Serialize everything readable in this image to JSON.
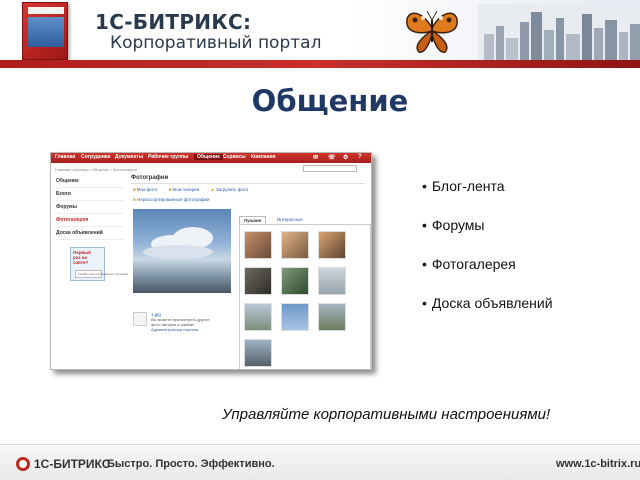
{
  "header": {
    "brand": "1С-БИТРИКС:",
    "product": "Корпоративный портал"
  },
  "page_title": "Общение",
  "screenshot": {
    "nav_items": [
      "Главная",
      "Сотрудники",
      "Документы",
      "Рабочие группы",
      "Общение",
      "Сервисы",
      "Компания"
    ],
    "active_nav": "Общение",
    "breadcrumb": "Главная страница / Общение / Фотогалерея",
    "sidebar": [
      "Общение",
      "Блоги",
      "Форумы",
      "Фотогалерея",
      "Доска объявлений"
    ],
    "active_sidebar": "Фотогалерея",
    "promo": {
      "text": "Первый раз на сайте?",
      "button": "Узнайте как пользоваться порталом"
    },
    "main_title": "Фотографии",
    "tools": [
      "Мои фото",
      "Мои галереи",
      "Загрузить фото"
    ],
    "selection_link": "Нерассортированные фотографии",
    "user": {
      "name": "1.jpg",
      "note_line1": "Вы можете просмотреть другие",
      "note_line2": "фото авторов в рамках",
      "note_link": "Администратора портала"
    },
    "tabs": [
      "Лучшие",
      "Интересные"
    ],
    "active_tab": "Лучшие"
  },
  "features": [
    "Блог-лента",
    "Форумы",
    "Фотогалерея",
    "Доска объявлений"
  ],
  "slogan": "Управляйте корпоративными настроениями!",
  "footer": {
    "logo": "1С-БИТРИКС",
    "tagline": "Быстро. Просто. Эффективно.",
    "url": "www.1c-bitrix.ru"
  },
  "colors": {
    "accent_red": "#c0281f",
    "title_blue": "#1f3864",
    "link_blue": "#2a5db0"
  }
}
